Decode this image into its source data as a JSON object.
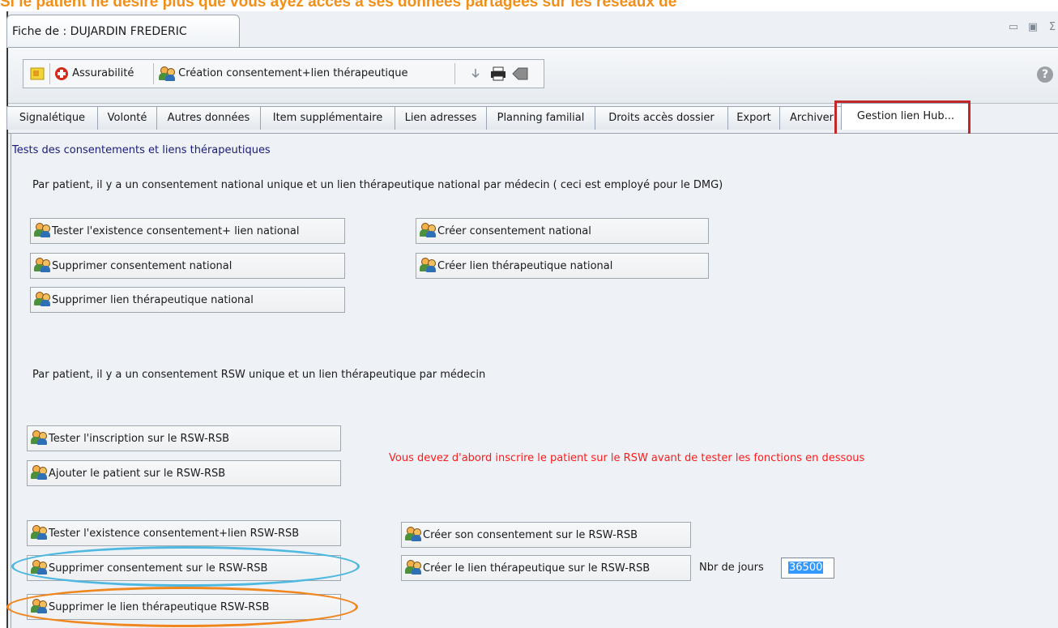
{
  "banner": {
    "text": "Si le patient ne désire plus que vous ayez accès à ses données partagées sur les réseaux de"
  },
  "window": {
    "title": "Fiche de : DUJARDIN FREDERIC",
    "controls": {
      "minimize": "▭",
      "restore": "▣",
      "close": "Σ"
    }
  },
  "toolbar": {
    "assurabilite": "Assurabilité",
    "creation": "Création consentement+lien thérapeutique"
  },
  "tabs": [
    "Signalétique",
    "Volonté",
    "Autres données",
    "Item supplémentaire",
    "Lien adresses",
    "Planning familial",
    "Droits accès dossier",
    "Export",
    "Archiver",
    "Gestion lien Hub..."
  ],
  "panel": {
    "title": "Tests des consentements et liens thérapeutiques",
    "national_desc": "Par patient, il y a un consentement national unique et un lien thérapeutique national par médecin ( ceci est employé pour le DMG)",
    "rsw_desc": "Par patient, il y a un consentement RSW unique et un lien thérapeutique par médecin",
    "warning": "Vous devez d'abord inscrire le patient sur le RSW avant de tester les fonctions en dessous",
    "warning_color": "#ff1a1a",
    "buttons": {
      "test_national": "Tester l'existence consentement+ lien national",
      "create_consent_national": "Créer consentement national",
      "delete_consent_national": "Supprimer consentement national",
      "create_link_national": "Créer lien thérapeutique national",
      "delete_link_national": "Supprimer lien thérapeutique national",
      "test_rsw_inscription": "Tester l'inscription sur le RSW-RSB",
      "add_patient_rsw": "Ajouter le patient sur le RSW-RSB",
      "test_consent_rsw": "Tester l'existence consentement+lien RSW-RSB",
      "create_consent_rsw": "Créer son consentement sur le RSW-RSB",
      "delete_consent_rsw": "Supprimer consentement sur le RSW-RSB",
      "create_link_rsw": "Créer le lien thérapeutique sur le RSW-RSB",
      "delete_link_rsw": "Supprimer le lien thérapeutique RSW-RSB"
    },
    "nbr_jours_label": "Nbr de jours",
    "nbr_jours_value": "36500"
  },
  "annotations": {
    "highlight_color": "#c0282a",
    "blue_ellipse_color": "#4fb8e0",
    "orange_ellipse_color": "#f0861e"
  }
}
